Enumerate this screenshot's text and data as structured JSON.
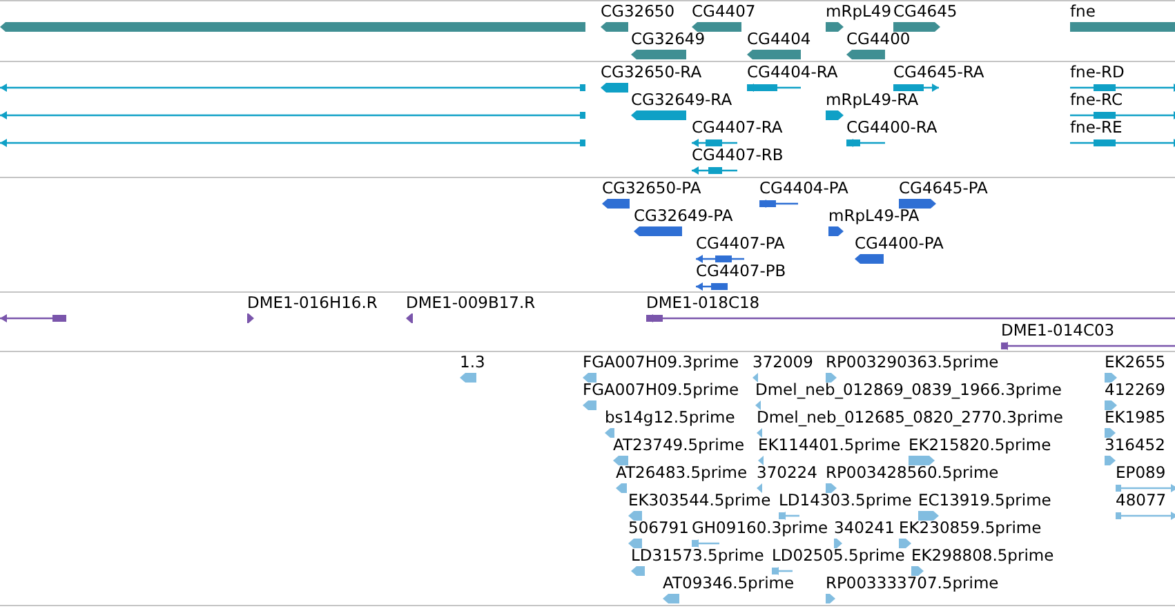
{
  "tracks": [
    {
      "kind": "gene",
      "features": [
        {
          "reverse": true
        },
        {
          "label": "CG32650",
          "reverse": true
        },
        {
          "label": "CG4407",
          "reverse": true
        },
        {
          "label": "mRpL49",
          "reverse": false
        },
        {
          "label": "CG4645",
          "reverse": false
        },
        {
          "label": "fne",
          "reverse": false
        },
        {
          "label": "CG32649",
          "reverse": true
        },
        {
          "label": "CG4404",
          "reverse": true
        },
        {
          "label": "CG4400",
          "reverse": true
        }
      ]
    },
    {
      "kind": "transcript",
      "features": [
        {
          "reverse": true
        },
        {
          "reverse": true
        },
        {
          "reverse": true
        },
        {
          "label": "CG32650-RA",
          "reverse": true
        },
        {
          "label": "CG4404-RA",
          "reverse": true
        },
        {
          "label": "CG4645-RA",
          "reverse": false
        },
        {
          "label": "fne-RD",
          "reverse": false
        },
        {
          "label": "CG32649-RA",
          "reverse": true
        },
        {
          "label": "mRpL49-RA",
          "reverse": false
        },
        {
          "label": "fne-RC",
          "reverse": false
        },
        {
          "label": "CG4407-RA",
          "reverse": true
        },
        {
          "label": "CG4400-RA",
          "reverse": true
        },
        {
          "label": "fne-RE",
          "reverse": false
        },
        {
          "label": "CG4407-RB",
          "reverse": true
        }
      ]
    },
    {
      "kind": "protein",
      "features": [
        {
          "label": "CG32650-PA",
          "reverse": true
        },
        {
          "label": "CG4404-PA",
          "reverse": true
        },
        {
          "label": "CG4645-PA",
          "reverse": false
        },
        {
          "label": "CG32649-PA",
          "reverse": true
        },
        {
          "label": "mRpL49-PA",
          "reverse": false
        },
        {
          "label": "CG4407-PA",
          "reverse": true
        },
        {
          "label": "CG4400-PA",
          "reverse": true
        },
        {
          "label": "CG4407-PB",
          "reverse": true
        }
      ]
    },
    {
      "kind": "clone",
      "features": [
        {
          "reverse": true
        },
        {
          "label": "DME1-016H16.R",
          "reverse": false
        },
        {
          "label": "DME1-009B17.R",
          "reverse": true
        },
        {
          "label": "DME1-018C18",
          "reverse": true
        },
        {
          "label": "DME1-014C03",
          "reverse": true
        }
      ]
    },
    {
      "kind": "est",
      "features": [
        {
          "label": "1.3",
          "reverse": true
        },
        {
          "label": "FGA007H09.3prime",
          "reverse": true
        },
        {
          "label": "372009",
          "reverse": true
        },
        {
          "label": "RP003290363.5prime",
          "reverse": false
        },
        {
          "label": "EK2655",
          "reverse": false
        },
        {
          "label": "FGA007H09.5prime",
          "reverse": true
        },
        {
          "label": "Dmel_neb_012869_0839_1966.3prime",
          "reverse": true
        },
        {
          "label": "412269",
          "reverse": false
        },
        {
          "label": "bs14g12.5prime",
          "reverse": true
        },
        {
          "label": "Dmel_neb_012685_0820_2770.3prime",
          "reverse": true
        },
        {
          "label": "EK1985",
          "reverse": false
        },
        {
          "label": "AT23749.5prime",
          "reverse": true
        },
        {
          "label": "EK114401.5prime",
          "reverse": true
        },
        {
          "label": "EK215820.5prime",
          "reverse": false
        },
        {
          "label": "316452",
          "reverse": false
        },
        {
          "label": "AT26483.5prime",
          "reverse": true
        },
        {
          "label": "370224",
          "reverse": true
        },
        {
          "label": "RP003428560.5prime",
          "reverse": false
        },
        {
          "label": "EP089",
          "reverse": false
        },
        {
          "label": "EK303544.5prime",
          "reverse": true
        },
        {
          "label": "LD14303.5prime",
          "reverse": true
        },
        {
          "label": "EC13919.5prime",
          "reverse": false
        },
        {
          "label": "48077",
          "reverse": false
        },
        {
          "label": "506791",
          "reverse": true
        },
        {
          "label": "GH09160.3prime",
          "reverse": true
        },
        {
          "label": "340241",
          "reverse": false
        },
        {
          "label": "EK230859.5prime",
          "reverse": false
        },
        {
          "label": "LD31573.5prime",
          "reverse": true
        },
        {
          "label": "LD02505.5prime",
          "reverse": true
        },
        {
          "label": "EK298808.5prime",
          "reverse": false
        },
        {
          "label": "AT09346.5prime",
          "reverse": true
        },
        {
          "label": "RP003333707.5prime",
          "reverse": false
        }
      ]
    }
  ]
}
